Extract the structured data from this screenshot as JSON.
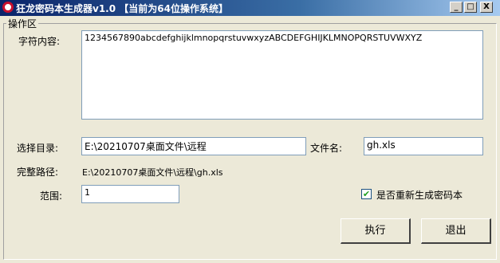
{
  "window": {
    "title": "狂龙密码本生成器v1.0 【当前为64位操作系统】",
    "minimize_glyph": "_",
    "maximize_glyph": "□",
    "close_glyph": "X"
  },
  "group": {
    "legend": "操作区"
  },
  "form": {
    "charset_label": "字符内容:",
    "charset_value": "1234567890abcdefghijklmnopqrstuvwxyzABCDEFGHIJKLMNOPQRSTUVWXYZ",
    "dir_label": "选择目录:",
    "dir_value": "E:\\20210707桌面文件\\远程",
    "filename_label": "文件名:",
    "filename_value": "gh.xls",
    "fullpath_label": "完整路径:",
    "fullpath_value": "E:\\20210707桌面文件\\远程\\gh.xls",
    "range_label": "范围:",
    "range_value": "1",
    "regen_checked": true,
    "regen_check_glyph": "✔",
    "regen_label": "是否重新生成密码本"
  },
  "buttons": {
    "run": "执行",
    "exit": "退出"
  },
  "icons": [
    "app-icon",
    "minimize-icon",
    "maximize-icon",
    "close-icon",
    "checkbox-check-icon"
  ]
}
